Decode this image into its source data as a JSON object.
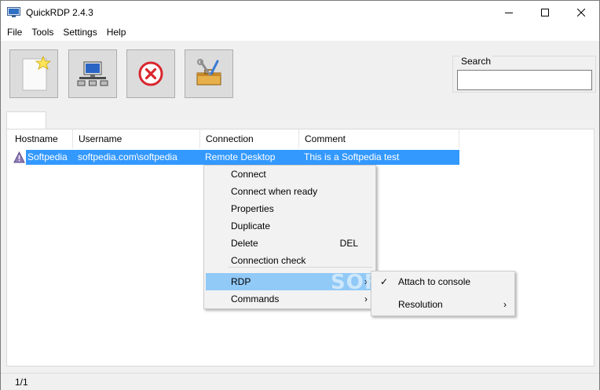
{
  "window": {
    "title": "QuickRDP 2.4.3"
  },
  "menu": [
    "File",
    "Tools",
    "Settings",
    "Help"
  ],
  "search": {
    "label": "Search",
    "value": "",
    "placeholder": ""
  },
  "tab": {
    "label": ""
  },
  "columns": [
    "Hostname",
    "Username",
    "Connection",
    "Comment"
  ],
  "rows": [
    {
      "hostname": "Softpedia",
      "username": "softpedia.com\\softpedia",
      "connection": "Remote Desktop",
      "comment": "This is a Softpedia test"
    }
  ],
  "context_menu": {
    "items": [
      {
        "label": "Connect"
      },
      {
        "label": "Connect when ready"
      },
      {
        "label": "Properties"
      },
      {
        "label": "Duplicate"
      },
      {
        "label": "Delete",
        "shortcut": "DEL"
      },
      {
        "label": "Connection check"
      },
      {
        "label": "RDP",
        "arrow": "›"
      },
      {
        "label": "Commands",
        "arrow": "›"
      }
    ]
  },
  "submenu": {
    "items": [
      {
        "label": "Attach to console",
        "check": "✓"
      },
      {
        "label": "Resolution",
        "arrow": "›"
      }
    ]
  },
  "watermark": "SOFTPEDIA",
  "status": {
    "text": "1/1"
  },
  "colors": {
    "selection": "#3399ff",
    "menu_highlight": "#91c9f7",
    "delete_red": "#d9262e"
  }
}
